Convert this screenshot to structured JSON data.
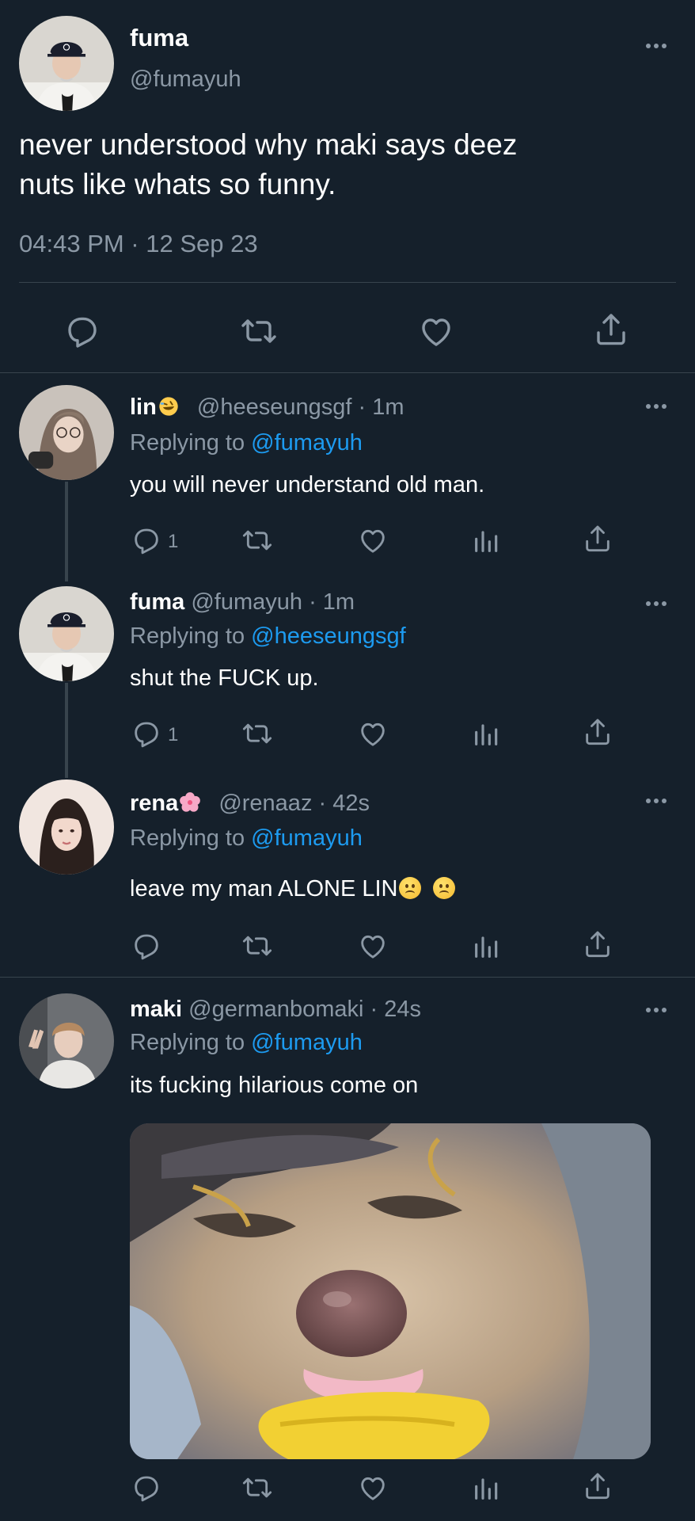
{
  "main_tweet": {
    "display_name": "fuma",
    "handle": "@fumayuh",
    "text_lines": [
      "never understood why maki says deez",
      "nuts like whats so funny."
    ],
    "timestamp": "04:43 PM · 12 Sep 23"
  },
  "replies": [
    {
      "display_name": "lin",
      "name_emoji": "rofl-emoji",
      "handle": "@heeseungsgf",
      "time": "· 1m",
      "replying_prefix": "Replying to",
      "replying_handle": "@fumayuh",
      "text": "you will never understand old man.",
      "reply_count": "1"
    },
    {
      "display_name": "fuma",
      "handle": "@fumayuh",
      "time": "· 1m",
      "replying_prefix": "Replying to",
      "replying_handle": "@heeseungsgf",
      "text": "shut the FUCK up.",
      "reply_count": "1"
    },
    {
      "display_name": "rena",
      "name_emoji": "cherry-blossom-emoji",
      "handle": "@renaaz",
      "time": "· 42s",
      "replying_prefix": "Replying to",
      "replying_handle": "@fumayuh",
      "text": "leave my man ALONE LIN",
      "text_emojis": [
        "slightly-frowning-face-emoji",
        "slightly-frowning-face-emoji"
      ],
      "reply_count": ""
    },
    {
      "display_name": "maki",
      "handle": "@germanbomaki",
      "time": "· 24s",
      "replying_prefix": "Replying to",
      "replying_handle": "@fumayuh",
      "text": "its fucking hilarious come on",
      "media": "dog-meme-photo",
      "reply_count": ""
    }
  ],
  "colors": {
    "background": "#15202b",
    "text": "#ffffff",
    "muted": "#8b98a5",
    "link": "#1d9bf0",
    "divider": "#38444d"
  }
}
